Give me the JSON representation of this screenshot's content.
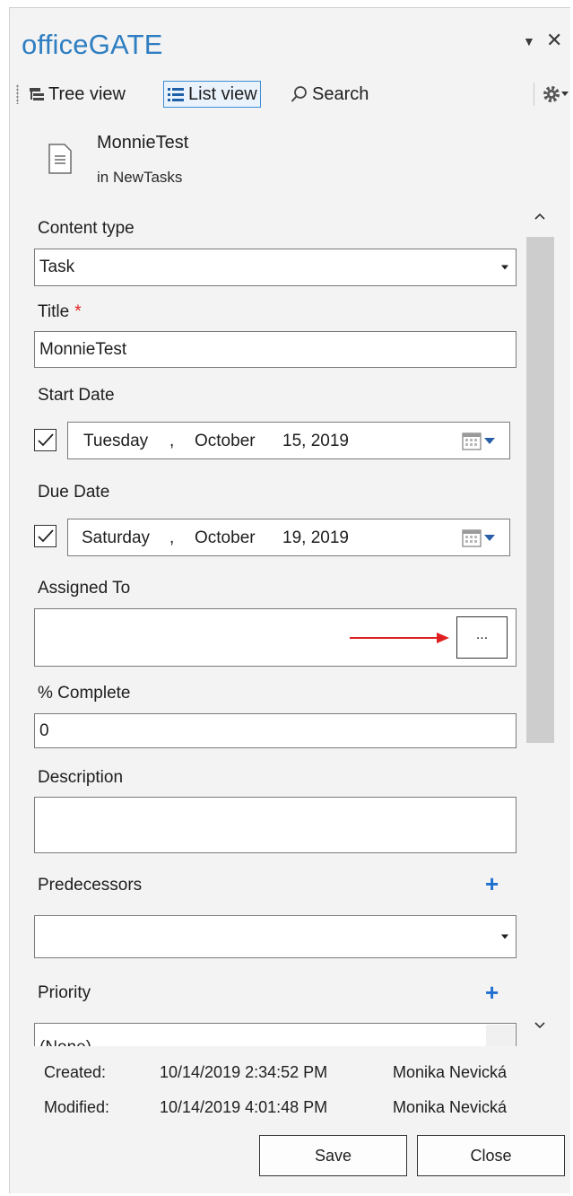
{
  "app": {
    "title": "officeGATE",
    "menu_glyph": "▼",
    "close_glyph": "✕"
  },
  "toolbar": {
    "tree_view": "Tree view",
    "list_view": "List view",
    "search": "Search"
  },
  "item": {
    "name": "MonnieTest",
    "location": "in NewTasks"
  },
  "form": {
    "content_type": {
      "label": "Content type",
      "value": "Task"
    },
    "title": {
      "label": "Title",
      "required_mark": "*",
      "value": "MonnieTest"
    },
    "start_date": {
      "label": "Start Date",
      "checked": true,
      "weekday": "Tuesday",
      "comma": ",",
      "month": "October",
      "day_year": "15, 2019"
    },
    "due_date": {
      "label": "Due Date",
      "checked": true,
      "weekday": "Saturday",
      "comma": ",",
      "month": "October",
      "day_year": "19, 2019"
    },
    "assigned_to": {
      "label": "Assigned To",
      "value": "",
      "browse_label": "..."
    },
    "percent_complete": {
      "label": "% Complete",
      "value": "0"
    },
    "description": {
      "label": "Description",
      "value": ""
    },
    "predecessors": {
      "label": "Predecessors",
      "add_glyph": "+",
      "value": ""
    },
    "priority": {
      "label": "Priority",
      "add_glyph": "+",
      "value": "(None)"
    }
  },
  "footer": {
    "created": {
      "label": "Created:",
      "datetime": "10/14/2019 2:34:52 PM",
      "user": "Monika Nevická"
    },
    "modified": {
      "label": "Modified:",
      "datetime": "10/14/2019 4:01:48 PM",
      "user": "Monika Nevická"
    },
    "save_label": "Save",
    "close_label": "Close"
  },
  "colors": {
    "brand": "#2f7ec1",
    "accent_plus": "#1e6fd0",
    "required": "#e02020",
    "arrow": "#e02020"
  }
}
